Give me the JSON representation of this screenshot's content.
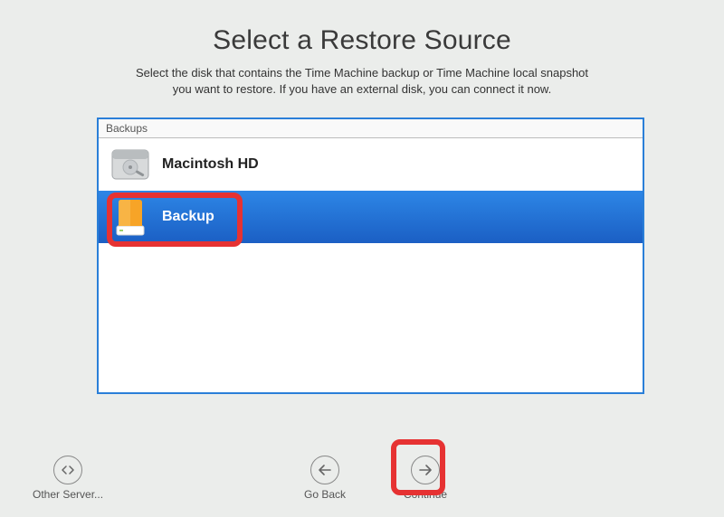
{
  "header": {
    "title": "Select a Restore Source",
    "subtitle_line1": "Select the disk that contains the Time Machine backup or Time Machine local snapshot",
    "subtitle_line2": "you want to restore. If you have an external disk, you can connect it now."
  },
  "list": {
    "column_header": "Backups",
    "items": [
      {
        "label": "Macintosh HD",
        "selected": false,
        "icon": "internal-hd"
      },
      {
        "label": "Backup",
        "selected": true,
        "icon": "external-hd"
      }
    ]
  },
  "footer": {
    "other_server": "Other Server...",
    "go_back": "Go Back",
    "continue": "Continue"
  },
  "highlights": {
    "backup_item": true,
    "continue_button": true
  }
}
